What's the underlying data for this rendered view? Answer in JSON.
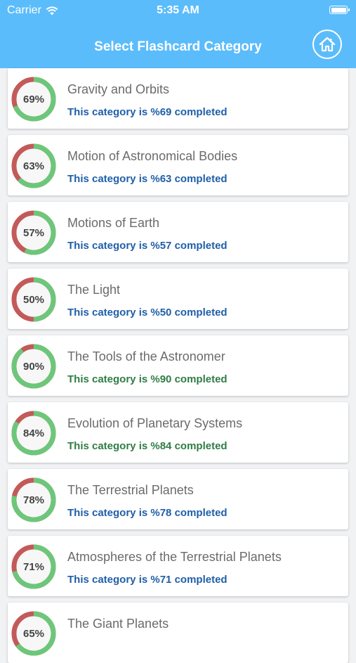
{
  "status_bar": {
    "carrier": "Carrier",
    "time": "5:35 AM"
  },
  "header": {
    "title": "Select Flashcard Category"
  },
  "colors": {
    "header_bg": "#5bbcfb",
    "ring_done": "#6cc77a",
    "ring_remaining": "#c35a5a",
    "status_blue": "#1f5fa8",
    "status_green": "#2f7d45"
  },
  "categories": [
    {
      "title": "Gravity and Orbits",
      "percent_label": "69%",
      "progress": 0.69,
      "status": "This category is %69 completed",
      "status_color": "#1f5fa8"
    },
    {
      "title": "Motion of Astronomical Bodies",
      "percent_label": "63%",
      "progress": 0.63,
      "status": "This category is %63 completed",
      "status_color": "#1f5fa8"
    },
    {
      "title": "Motions of Earth",
      "percent_label": "57%",
      "progress": 0.57,
      "status": "This category is %57 completed",
      "status_color": "#1f5fa8"
    },
    {
      "title": "The Light",
      "percent_label": "50%",
      "progress": 0.5,
      "status": "This category is %50 completed",
      "status_color": "#1f5fa8"
    },
    {
      "title": "The Tools of the Astronomer",
      "percent_label": "90%",
      "progress": 0.9,
      "status": "This category is %90 completed",
      "status_color": "#2f7d45"
    },
    {
      "title": "Evolution of Planetary Systems",
      "percent_label": "84%",
      "progress": 0.84,
      "status": "This category is %84 completed",
      "status_color": "#2f7d45"
    },
    {
      "title": "The Terrestrial Planets",
      "percent_label": "78%",
      "progress": 0.78,
      "status": "This category is %78 completed",
      "status_color": "#1f5fa8"
    },
    {
      "title": "Atmospheres of the Terrestrial Planets",
      "percent_label": "71%",
      "progress": 0.71,
      "status": "This category is %71 completed",
      "status_color": "#1f5fa8"
    },
    {
      "title": "The Giant Planets",
      "percent_label": "65%",
      "progress": 0.65,
      "status": "",
      "status_color": "#1f5fa8"
    }
  ]
}
